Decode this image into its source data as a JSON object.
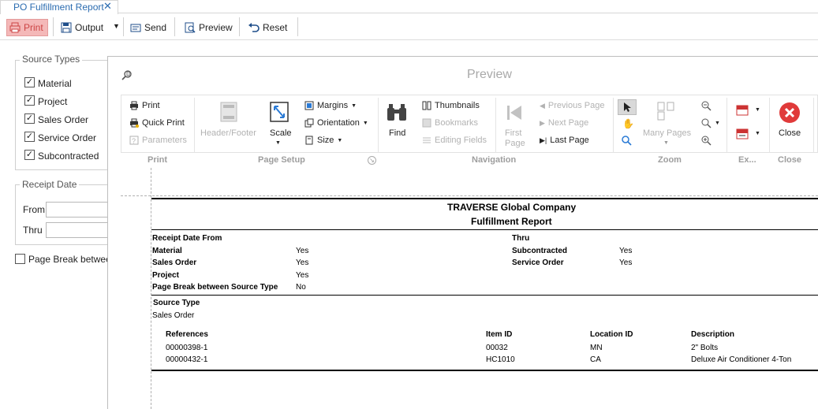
{
  "tab": {
    "title": "PO Fulfillment Report",
    "close": "✕"
  },
  "toolbar": {
    "print": "Print",
    "output": "Output",
    "send": "Send",
    "preview": "Preview",
    "reset": "Reset"
  },
  "left": {
    "source_types_legend": "Source Types",
    "source_types": [
      {
        "label": "Material",
        "checked": true
      },
      {
        "label": "Project",
        "checked": true
      },
      {
        "label": "Sales Order",
        "checked": true
      },
      {
        "label": "Service Order",
        "checked": true
      },
      {
        "label": "Subcontracted",
        "checked": true
      }
    ],
    "receipt_date_legend": "Receipt Date",
    "from_label": "From",
    "thru_label": "Thru",
    "page_break_label": "Page Break between",
    "page_break_checked": false
  },
  "preview": {
    "title": "Preview",
    "ribbon": {
      "print": "Print",
      "quick_print": "Quick Print",
      "parameters": "Parameters",
      "header_footer": "Header/Footer",
      "scale": "Scale",
      "margins": "Margins",
      "orientation": "Orientation",
      "size": "Size",
      "find": "Find",
      "thumbnails": "Thumbnails",
      "bookmarks": "Bookmarks",
      "editing_fields": "Editing Fields",
      "first_page_1": "First",
      "first_page_2": "Page",
      "previous_page": "Previous Page",
      "next_page": "Next Page",
      "last_page": "Last Page",
      "many_pages": "Many Pages",
      "close": "Close",
      "groups": {
        "print": "Print",
        "page_setup": "Page Setup",
        "navigation": "Navigation",
        "zoom": "Zoom",
        "export": "Ex...",
        "close": "Close"
      }
    }
  },
  "report": {
    "company": "TRAVERSE Global Company",
    "title": "Fulfillment Report",
    "params_left": [
      {
        "label": "Receipt Date From",
        "value": ""
      },
      {
        "label": "Material",
        "value": "Yes"
      },
      {
        "label": "Sales Order",
        "value": "Yes"
      },
      {
        "label": "Project",
        "value": "Yes"
      },
      {
        "label": "Page Break between Source Type",
        "value": "No"
      }
    ],
    "params_right": [
      {
        "label": "Thru",
        "value": ""
      },
      {
        "label": "Subcontracted",
        "value": "Yes"
      },
      {
        "label": "Service Order",
        "value": "Yes"
      }
    ],
    "source_type_label": "Source Type",
    "source_type_value": "Sales Order",
    "columns": [
      "References",
      "Item ID",
      "Location ID",
      "Description"
    ],
    "rows": [
      {
        "ref": "00000398-1",
        "item": "00032",
        "loc": "MN",
        "desc": "2\" Bolts"
      },
      {
        "ref": "00000432-1",
        "item": "HC1010",
        "loc": "CA",
        "desc": "Deluxe Air Conditioner 4-Ton"
      }
    ]
  }
}
